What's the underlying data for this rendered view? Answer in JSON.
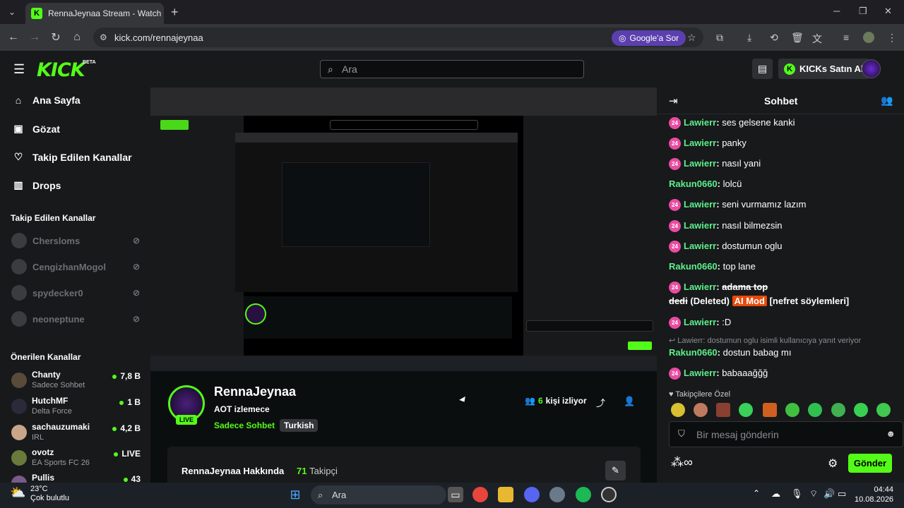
{
  "browser": {
    "tab_title": "RennaJeynaa Stream - Watch Li",
    "url": "kick.com/rennajeynaa",
    "google_sor": "Google'a Sor"
  },
  "header": {
    "logo": "KICK",
    "beta": "BETA",
    "search_placeholder": "Ara",
    "kicks_button": "KICKs Satın Al"
  },
  "sidebar": {
    "nav": [
      {
        "label": "Ana Sayfa",
        "icon": "home-icon"
      },
      {
        "label": "Gözat",
        "icon": "browse-icon"
      },
      {
        "label": "Takip Edilen Kanallar",
        "icon": "heart-icon"
      },
      {
        "label": "Drops",
        "icon": "drops-icon"
      }
    ],
    "followed_title": "Takip Edilen Kanallar",
    "followed": [
      "Chersloms",
      "CengizhanMogol",
      "spydecker0",
      "neoneptune"
    ],
    "recommended_title": "Önerilen Kanallar",
    "recommended": [
      {
        "name": "Chanty",
        "category": "Sadece Sohbet",
        "viewers": "7,8 B"
      },
      {
        "name": "HutchMF",
        "category": "Delta Force",
        "viewers": "1 B"
      },
      {
        "name": "sachauzumaki",
        "category": "IRL",
        "viewers": "4,2 B"
      },
      {
        "name": "ovotz",
        "category": "EA Sports FC 26",
        "viewers": "LIVE"
      },
      {
        "name": "Pullis",
        "category": "",
        "viewers": "43"
      }
    ]
  },
  "channel": {
    "name": "RennaJeynaa",
    "title": "AOT izlemece",
    "category": "Sadece Sohbet",
    "tag": "Turkish",
    "live": "LIVE",
    "viewer_count": "6",
    "viewer_label": "kişi izliyor",
    "about_title": "RennaJeynaa Hakkında",
    "followers_count": "71",
    "followers_label": "Takipçi"
  },
  "chat": {
    "title": "Sohbet",
    "reply_hint": "Lawierr: dostumun oglu isimli kullanıcıya yanıt veriyor",
    "emote_header": "Takipçilere Özel",
    "input_placeholder": "Bir mesaj gönderin",
    "send": "Gönder",
    "badge": "24",
    "messages": [
      {
        "user": "Lawierr",
        "text": "ses gelsene kanki"
      },
      {
        "user": "Lawierr",
        "text": "panky"
      },
      {
        "user": "Lawierr",
        "text": "nasıl yani"
      },
      {
        "user": "Rakun0660",
        "text": "lolcü"
      },
      {
        "user": "Lawierr",
        "text": "seni vurmamız lazım"
      },
      {
        "user": "Lawierr",
        "text": "nasıl bilmezsin"
      },
      {
        "user": "Lawierr",
        "text": "dostumun oglu"
      },
      {
        "user": "Rakun0660",
        "text": "top lane"
      },
      {
        "user": "Lawierr",
        "deleted_text_1": "adama top",
        "deleted_text_2": "dedi",
        "deleted_label": "(Deleted)",
        "mod_label": "AI Mod",
        "reason": "[nefret söylemleri]"
      },
      {
        "user": "Lawierr",
        "text": ":D"
      },
      {
        "user": "Rakun0660",
        "text": "dostun babag mı"
      },
      {
        "user": "Lawierr",
        "text": "babaaağğğ"
      }
    ]
  },
  "taskbar": {
    "temp": "23°C",
    "weather": "Çok bulutlu",
    "search": "Ara",
    "time": "04:44",
    "date": "10.08.2026"
  },
  "colors": {
    "accent": "#53fc18",
    "badge": "#e94ca2",
    "aimod": "#e8490a"
  }
}
